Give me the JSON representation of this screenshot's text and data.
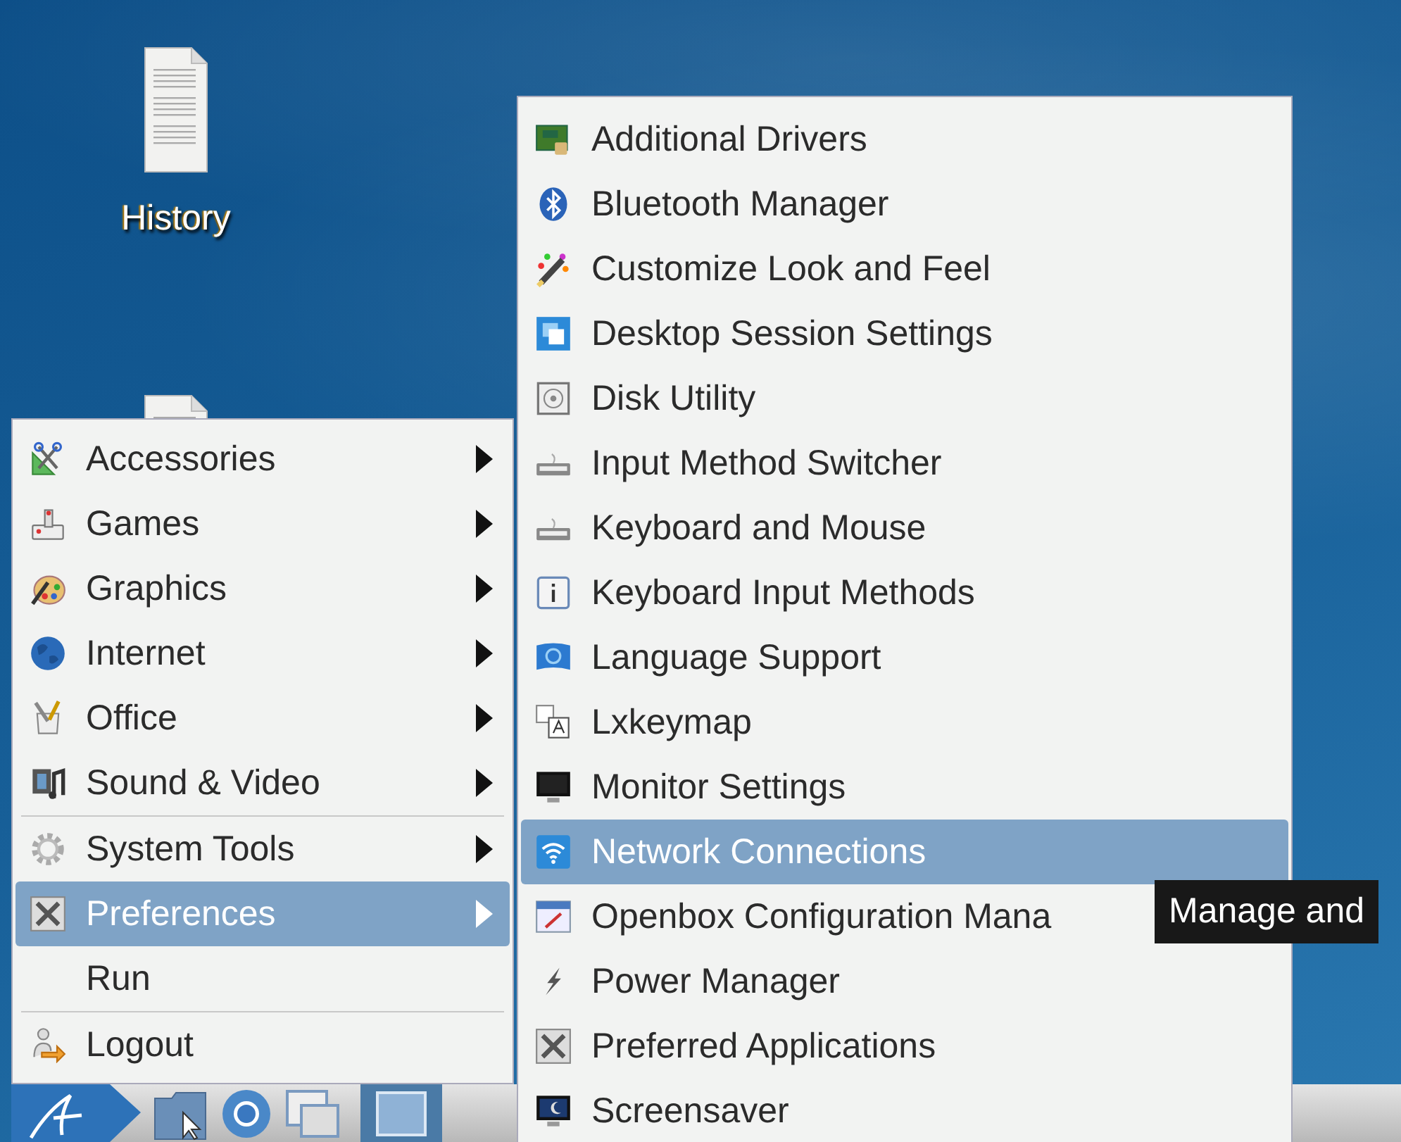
{
  "desktop_icons": [
    {
      "kind": "document",
      "label": "History"
    },
    {
      "kind": "document"
    }
  ],
  "main_menu": {
    "items": [
      {
        "kind": "submenu",
        "label": "Accessories",
        "selected": false
      },
      {
        "kind": "submenu",
        "label": "Games",
        "selected": false
      },
      {
        "kind": "submenu",
        "label": "Graphics",
        "selected": false
      },
      {
        "kind": "submenu",
        "label": "Internet",
        "selected": false
      },
      {
        "kind": "submenu",
        "label": "Office",
        "selected": false
      },
      {
        "kind": "submenu",
        "label": "Sound & Video",
        "selected": false
      },
      {
        "kind": "separator"
      },
      {
        "kind": "submenu",
        "label": "System Tools",
        "selected": false
      },
      {
        "kind": "submenu",
        "label": "Preferences",
        "selected": true
      },
      {
        "kind": "action",
        "label": "Run",
        "selected": false
      },
      {
        "kind": "separator"
      },
      {
        "kind": "action",
        "label": "Logout",
        "selected": false
      }
    ]
  },
  "submenu": {
    "items": [
      {
        "label": "Additional Drivers",
        "selected": false
      },
      {
        "label": "Bluetooth Manager",
        "selected": false
      },
      {
        "label": "Customize Look and Feel",
        "selected": false
      },
      {
        "label": "Desktop Session Settings",
        "selected": false
      },
      {
        "label": "Disk Utility",
        "selected": false
      },
      {
        "label": "Input Method Switcher",
        "selected": false
      },
      {
        "label": "Keyboard and Mouse",
        "selected": false
      },
      {
        "label": "Keyboard Input Methods",
        "selected": false
      },
      {
        "label": "Language Support",
        "selected": false
      },
      {
        "label": "Lxkeymap",
        "selected": false
      },
      {
        "label": "Monitor Settings",
        "selected": false
      },
      {
        "label": "Network Connections",
        "selected": true
      },
      {
        "label": "Openbox Configuration Mana",
        "selected": false
      },
      {
        "label": "Power Manager",
        "selected": false
      },
      {
        "label": "Preferred Applications",
        "selected": false
      },
      {
        "label": "Screensaver",
        "selected": false
      }
    ]
  },
  "tooltip": {
    "text": "Manage and"
  }
}
